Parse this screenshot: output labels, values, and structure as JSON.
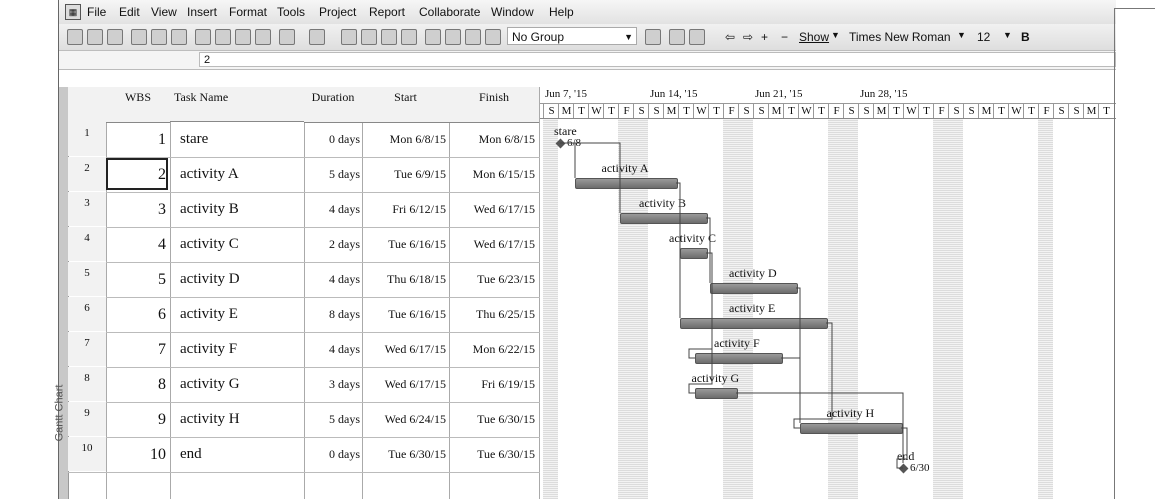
{
  "menu": {
    "icon_name": "app-icon",
    "items": [
      "File",
      "Edit",
      "View",
      "Insert",
      "Format",
      "Tools",
      "Project",
      "Report",
      "Collaborate",
      "Window",
      "Help"
    ]
  },
  "toolbar": {
    "group_value": "No Group",
    "show_label": "Show",
    "font_value": "Times New Roman",
    "size_value": "12",
    "bold_label": "B"
  },
  "entry_bar": {
    "value": "2"
  },
  "sidebar": {
    "label": "Gantt Chart"
  },
  "table": {
    "headers": [
      "",
      "WBS",
      "Task Name",
      "Duration",
      "Start",
      "Finish"
    ],
    "rows": [
      {
        "id": "1",
        "wbs": "1",
        "name": "stare",
        "duration": "0 days",
        "start": "Mon 6/8/15",
        "finish": "Mon 6/8/15"
      },
      {
        "id": "2",
        "wbs": "2",
        "name": "activity A",
        "duration": "5 days",
        "start": "Tue 6/9/15",
        "finish": "Mon 6/15/15"
      },
      {
        "id": "3",
        "wbs": "3",
        "name": "activity B",
        "duration": "4 days",
        "start": "Fri 6/12/15",
        "finish": "Wed 6/17/15"
      },
      {
        "id": "4",
        "wbs": "4",
        "name": "activity C",
        "duration": "2 days",
        "start": "Tue 6/16/15",
        "finish": "Wed 6/17/15"
      },
      {
        "id": "5",
        "wbs": "5",
        "name": "activity D",
        "duration": "4 days",
        "start": "Thu 6/18/15",
        "finish": "Tue 6/23/15"
      },
      {
        "id": "6",
        "wbs": "6",
        "name": "activity E",
        "duration": "8 days",
        "start": "Tue 6/16/15",
        "finish": "Thu 6/25/15"
      },
      {
        "id": "7",
        "wbs": "7",
        "name": "activity F",
        "duration": "4 days",
        "start": "Wed 6/17/15",
        "finish": "Mon 6/22/15"
      },
      {
        "id": "8",
        "wbs": "8",
        "name": "activity G",
        "duration": "3 days",
        "start": "Wed 6/17/15",
        "finish": "Fri 6/19/15"
      },
      {
        "id": "9",
        "wbs": "9",
        "name": "activity H",
        "duration": "5 days",
        "start": "Wed 6/24/15",
        "finish": "Tue 6/30/15"
      },
      {
        "id": "10",
        "wbs": "10",
        "name": "end",
        "duration": "0 days",
        "start": "Tue 6/30/15",
        "finish": "Tue 6/30/15"
      }
    ]
  },
  "gantt": {
    "weeks": [
      "Jun 7, '15",
      "Jun 14, '15",
      "Jun 21, '15",
      "Jun 28, '15"
    ],
    "day_letters": [
      "S",
      "M",
      "T",
      "W",
      "T",
      "F",
      "S"
    ],
    "milestone_labels": {
      "start": "6/8",
      "end": "6/30"
    },
    "bar_color": "#7f7f7f"
  }
}
